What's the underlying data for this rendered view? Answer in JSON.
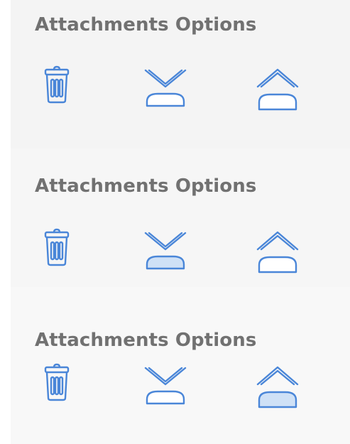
{
  "colors": {
    "icon": "#4a86d8",
    "icon_active_fill": "#cfe1f6",
    "title_text": "#717171"
  },
  "panels": [
    {
      "title": "Attachments Options",
      "icons": [
        "trash-icon",
        "move-down-icon",
        "move-up-icon"
      ],
      "active": "none"
    },
    {
      "title": "Attachments Options",
      "icons": [
        "trash-icon",
        "move-down-icon",
        "move-up-icon"
      ],
      "active": "move-down"
    },
    {
      "title": "Attachments Options",
      "icons": [
        "trash-icon",
        "move-down-icon",
        "move-up-icon"
      ],
      "active": "move-up"
    }
  ]
}
